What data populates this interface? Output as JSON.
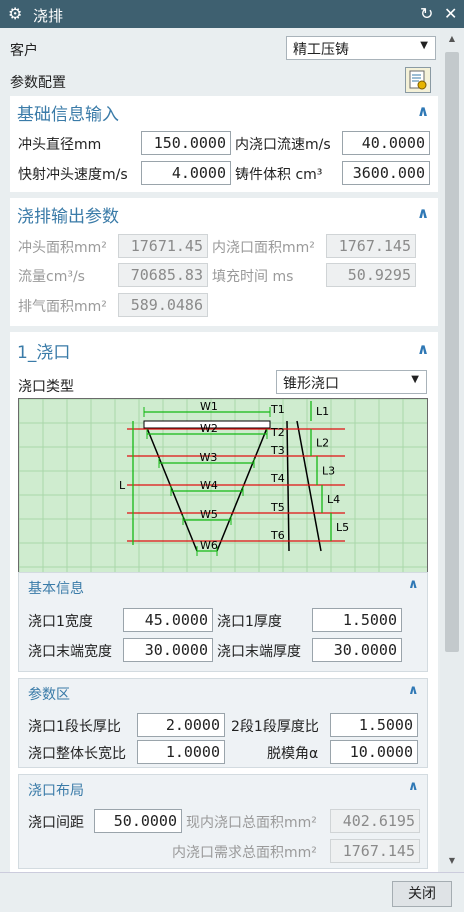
{
  "window": {
    "title": "浇排",
    "gear_icon": "gear-icon",
    "reset_icon": "reset-icon",
    "close_icon": "close-icon"
  },
  "customer": {
    "label": "客户",
    "value": "精工压铸"
  },
  "param_config": {
    "label": "参数配置"
  },
  "basic_input": {
    "title": "基础信息输入",
    "fields": [
      {
        "label": "冲头直径mm",
        "value": "150.0000"
      },
      {
        "label": "内浇口流速m/s",
        "value": "40.0000"
      },
      {
        "label": "快射冲头速度m/s",
        "value": "4.0000"
      },
      {
        "label": "铸件体积 cm³",
        "value": "3600.000"
      }
    ]
  },
  "output_params": {
    "title": "浇排输出参数",
    "fields": [
      {
        "label": "冲头面积mm²",
        "value": "17671.45"
      },
      {
        "label": "内浇口面积mm²",
        "value": "1767.145"
      },
      {
        "label": "流量cm³/s",
        "value": "70685.83"
      },
      {
        "label": "填充时间 ms",
        "value": "50.9295"
      },
      {
        "label": "排气面积mm²",
        "value": "589.0486"
      }
    ]
  },
  "gate": {
    "title": "1_浇口",
    "type_label": "浇口类型",
    "type_value": "锥形浇口",
    "diagram": {
      "widths": [
        "W1",
        "W2",
        "W3",
        "W4",
        "W5",
        "W6"
      ],
      "thick": [
        "T1",
        "T2",
        "T3",
        "T4",
        "T5",
        "T6"
      ],
      "lens": [
        "L1",
        "L2",
        "L3",
        "L4",
        "L5"
      ],
      "total": "L"
    },
    "basic": {
      "title": "基本信息",
      "fields": [
        {
          "label": "浇口1宽度",
          "value": "45.0000"
        },
        {
          "label": "浇口1厚度",
          "value": "1.5000"
        },
        {
          "label": "浇口末端宽度",
          "value": "30.0000"
        },
        {
          "label": "浇口末端厚度",
          "value": "30.0000"
        }
      ]
    },
    "params": {
      "title": "参数区",
      "fields": [
        {
          "label": "浇口1段长厚比",
          "value": "2.0000"
        },
        {
          "label": "2段1段厚度比",
          "value": "1.5000"
        },
        {
          "label": "浇口整体长宽比",
          "value": "1.0000"
        },
        {
          "label": "脱模角α",
          "value": "10.0000"
        }
      ]
    },
    "layout": {
      "title": "浇口布局",
      "spacing_label": "浇口间距",
      "spacing_value": "50.0000",
      "current_area_label": "现内浇口总面积mm²",
      "current_area_value": "402.6195",
      "required_area_label": "内浇口需求总面积mm²",
      "required_area_value": "1767.145"
    }
  },
  "footer": {
    "close_label": "关闭"
  }
}
